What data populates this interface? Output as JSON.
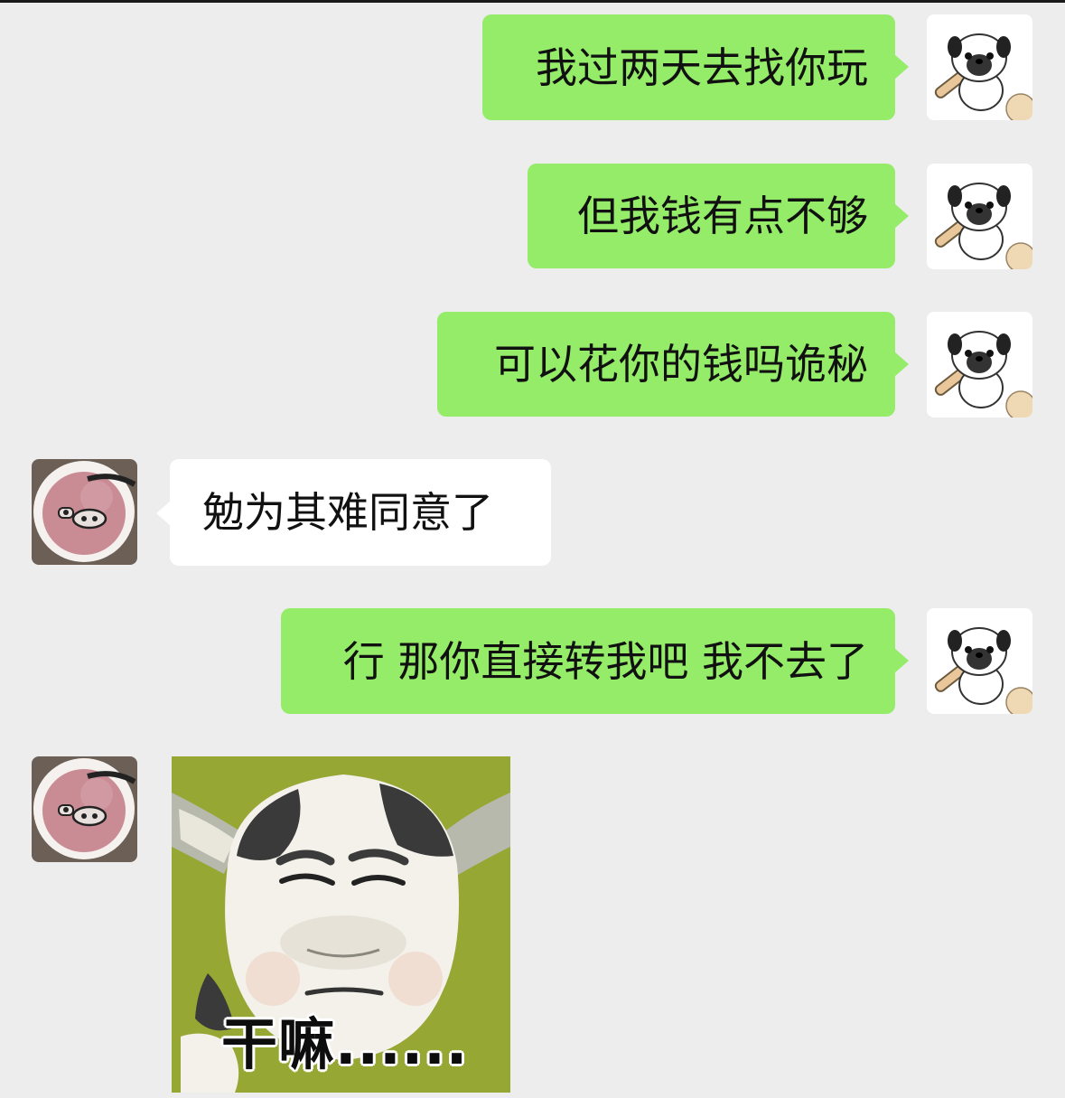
{
  "chat": {
    "messages": [
      {
        "sender": "me",
        "text": "我过两天去找你玩"
      },
      {
        "sender": "me",
        "text": "但我钱有点不够"
      },
      {
        "sender": "me",
        "text": "可以花你的钱吗诡秘"
      },
      {
        "sender": "them",
        "text": "勉为其难同意了"
      },
      {
        "sender": "me",
        "text": "行 那你直接转我吧 我不去了"
      },
      {
        "sender": "them",
        "type": "sticker",
        "caption": "干嘛......"
      }
    ]
  },
  "avatars": {
    "me": "pug-dog-avatar",
    "them": "pig-ice-cream-avatar"
  },
  "colors": {
    "background": "#ededed",
    "my_bubble": "#95ec69",
    "their_bubble": "#ffffff",
    "text": "#111111",
    "sticker_bg": "#8fa02e"
  }
}
